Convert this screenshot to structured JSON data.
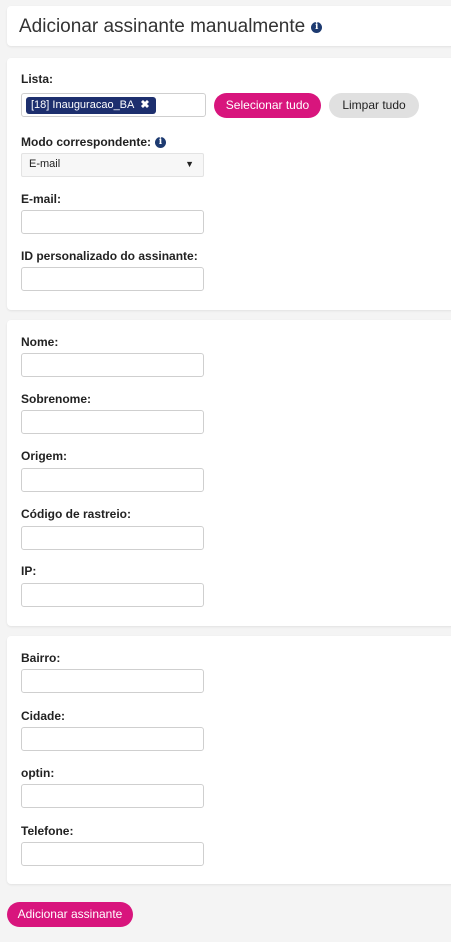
{
  "header": {
    "title": "Adicionar assinante manualmente",
    "info_icon": "info-icon"
  },
  "list_section": {
    "list_label": "Lista:",
    "selected_tag": "[18] Inauguracao_BA",
    "remove_glyph": "✖",
    "select_all_label": "Selecionar tudo",
    "clear_all_label": "Limpar tudo",
    "match_mode_label": "Modo correspondente:",
    "match_mode_value": "E-mail",
    "dropdown_glyph": "▼",
    "email_label": "E-mail:",
    "email_value": "",
    "custom_id_label": "ID personalizado do assinante:",
    "custom_id_value": ""
  },
  "personal_section": {
    "name_label": "Nome:",
    "surname_label": "Sobrenome:",
    "origin_label": "Origem:",
    "tracking_label": "Código de rastreio:",
    "ip_label": "IP:"
  },
  "address_section": {
    "neighborhood_label": "Bairro:",
    "city_label": "Cidade:",
    "optin_label": "optin:",
    "phone_label": "Telefone:"
  },
  "footer": {
    "add_subscriber_label": "Adicionar assinante"
  },
  "colors": {
    "accent": "#d8157d",
    "tag_bg": "#1d2f6e",
    "info_icon": "#1d3a70"
  }
}
